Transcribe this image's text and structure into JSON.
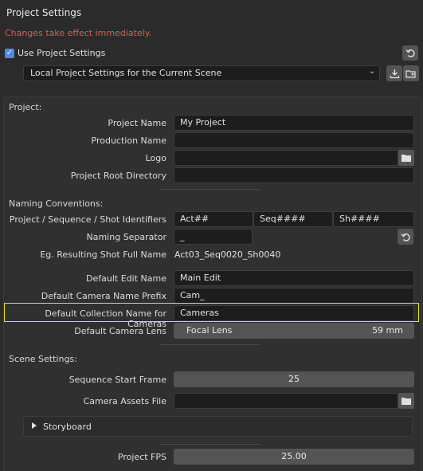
{
  "window": {
    "title": "Project Settings"
  },
  "warning": "Changes take effect immediately.",
  "use_project_settings": {
    "label": "Use Project Settings",
    "checked": true
  },
  "settings_source": {
    "value": "Local Project Settings for the Current Scene"
  },
  "icons": {
    "reset": "reset-icon",
    "import": "import-icon",
    "export": "export-folder-icon",
    "folder": "folder-icon",
    "dropdown": "chevron-down-icon",
    "expand": "triangle-right-icon"
  },
  "project": {
    "heading": "Project:",
    "name_label": "Project Name",
    "name_value": "My Project",
    "production_label": "Production Name",
    "production_value": "",
    "logo_label": "Logo",
    "logo_value": "",
    "root_label": "Project Root Directory",
    "root_value": ""
  },
  "naming": {
    "heading": "Naming Conventions:",
    "identifiers_label": "Project / Sequence / Shot Identifiers",
    "identifier_act": "Act##",
    "identifier_seq": "Seq####",
    "identifier_shot": "Sh####",
    "separator_label": "Naming Separator",
    "separator_value": "_",
    "example_label": "Eg. Resulting Shot Full Name",
    "example_value": "Act03_Seq0020_Sh0040",
    "edit_label": "Default Edit Name",
    "edit_value": "Main Edit",
    "camera_prefix_label": "Default Camera Name Prefix",
    "camera_prefix_value": "Cam_",
    "collection_label": "Default Collection Name for Cameras",
    "collection_value": "Cameras",
    "lens_label": "Default Camera Lens",
    "lens_name": "Focal Lens",
    "lens_value": "59 mm"
  },
  "scene": {
    "heading": "Scene Settings:",
    "start_frame_label": "Sequence Start Frame",
    "start_frame_value": "25",
    "camera_assets_label": "Camera Assets File",
    "camera_assets_value": "",
    "storyboard_label": "Storyboard",
    "fps_label": "Project FPS",
    "fps_value": "25.00"
  },
  "colors": {
    "accent": "#4a8ae0",
    "warning": "#e05a4f",
    "highlight": "#e6e600"
  }
}
